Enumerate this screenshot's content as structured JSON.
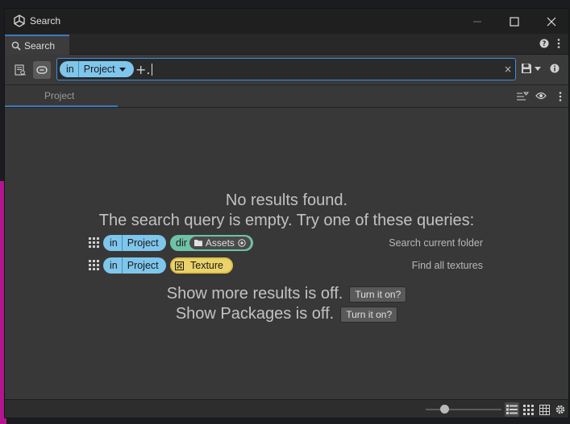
{
  "window": {
    "title": "Search"
  },
  "tab": {
    "label": "Search"
  },
  "searchbox": {
    "filter_in": "in",
    "filter_value": "Project",
    "add_symbol": "+.",
    "clear_symbol": "×"
  },
  "subtab": {
    "label": "Project"
  },
  "empty": {
    "line1": "No results found.",
    "line2": "The search query is empty. Try one of these queries:"
  },
  "queries": [
    {
      "in": "in",
      "value": "Project",
      "tag": "dir",
      "tag_value": "Assets",
      "description": "Search current folder"
    },
    {
      "in": "in",
      "value": "Project",
      "tag_value": "Texture",
      "description": "Find all textures"
    }
  ],
  "toggles": [
    {
      "text": "Show more results is off.",
      "button": "Turn it on?"
    },
    {
      "text": "Show Packages is off.",
      "button": "Turn it on?"
    }
  ],
  "statusbar": {
    "zoom_fraction": 0.25
  },
  "colors": {
    "accent": "#3a79bb",
    "pill_blue": "#7fc6ec",
    "pill_green": "#6fc2a7",
    "pill_yellow": "#ead36a",
    "magenta_bg": "#b3148f"
  }
}
